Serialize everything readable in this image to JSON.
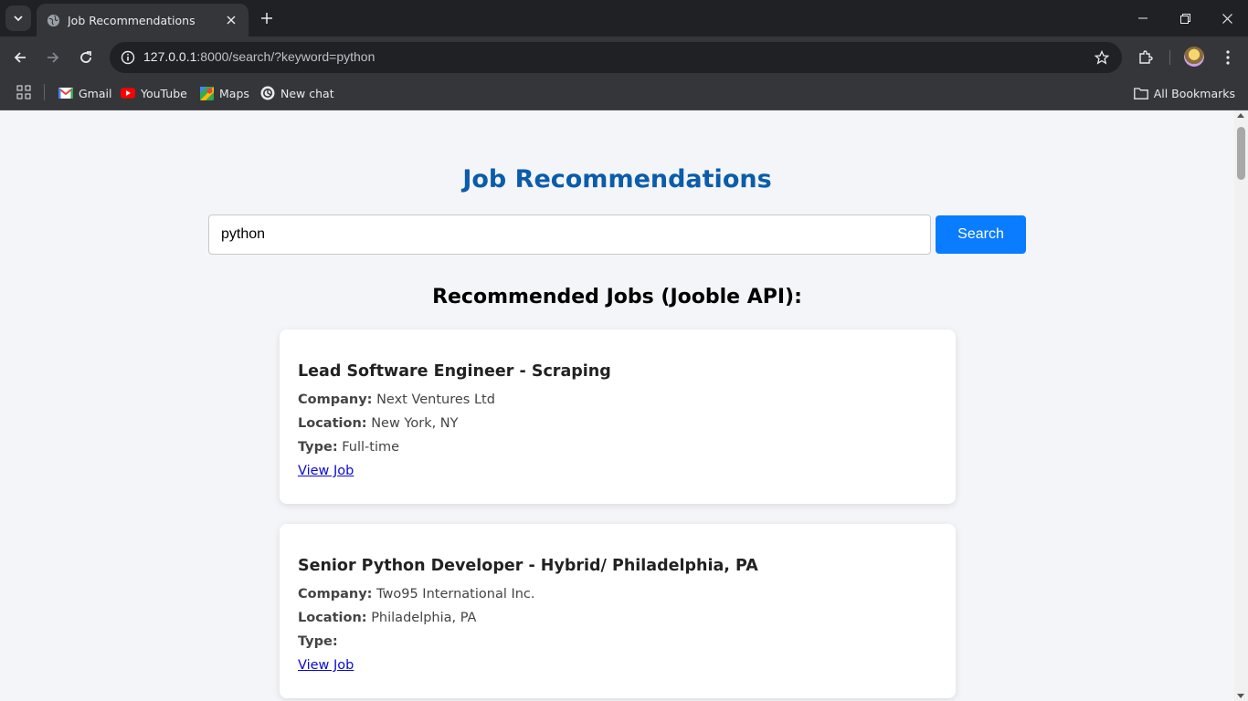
{
  "browser": {
    "tab": {
      "title": "Job Recommendations"
    },
    "address_bar": {
      "url_host": "127.0.0.1",
      "url_rest": ":8000/search/?keyword=python"
    },
    "bookmarks": [
      {
        "label": "Gmail",
        "icon": "gmail-icon"
      },
      {
        "label": "YouTube",
        "icon": "youtube-icon"
      },
      {
        "label": "Maps",
        "icon": "maps-icon"
      },
      {
        "label": "New chat",
        "icon": "chatgpt-icon"
      }
    ],
    "all_bookmarks_label": "All Bookmarks"
  },
  "page": {
    "title": "Job Recommendations",
    "search": {
      "value": "python",
      "button_label": "Search"
    },
    "section_title": "Recommended Jobs (Jooble API):",
    "labels": {
      "company": "Company:",
      "location": "Location:",
      "type": "Type:"
    },
    "jobs": [
      {
        "title": "Lead Software Engineer - Scraping",
        "company": "Next Ventures Ltd",
        "location": "New York, NY",
        "type": "Full-time",
        "link_label": "View Job"
      },
      {
        "title": "Senior Python Developer - Hybrid/ Philadelphia, PA",
        "company": "Two95 International Inc.",
        "location": "Philadelphia, PA",
        "type": "",
        "link_label": "View Job"
      }
    ]
  },
  "colors": {
    "title_blue": "#0b5cab",
    "button_blue": "#0a7cff",
    "page_bg": "#f4f5f9",
    "link": "#0a0ad6"
  }
}
